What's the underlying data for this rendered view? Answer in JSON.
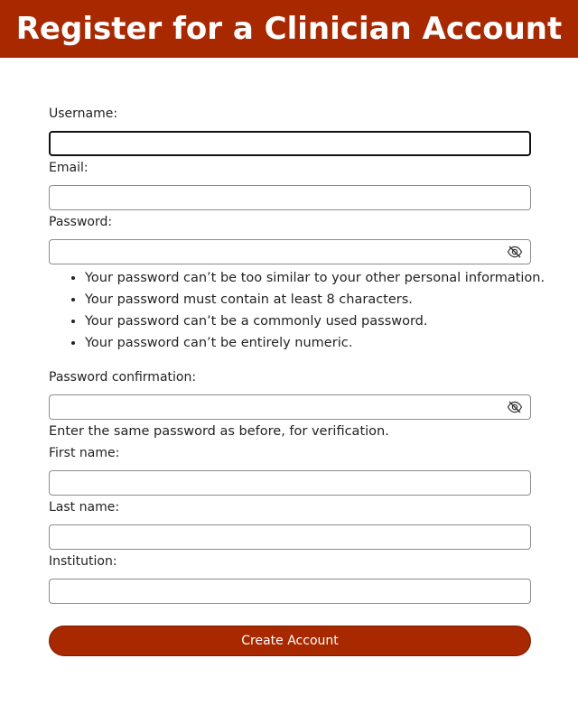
{
  "header": {
    "title": "Register for a Clinician Account"
  },
  "form": {
    "username": {
      "label": "Username:",
      "value": ""
    },
    "email": {
      "label": "Email:",
      "value": ""
    },
    "password": {
      "label": "Password:",
      "value": "",
      "toggle_icon": "eye-slash-icon",
      "rules": [
        "Your password can’t be too similar to your other personal information.",
        "Your password must contain at least 8 characters.",
        "Your password can’t be a commonly used password.",
        "Your password can’t be entirely numeric."
      ]
    },
    "password_confirmation": {
      "label": "Password confirmation:",
      "value": "",
      "toggle_icon": "eye-slash-icon",
      "help": "Enter the same password as before, for verification."
    },
    "first_name": {
      "label": "First name:",
      "value": ""
    },
    "last_name": {
      "label": "Last name:",
      "value": ""
    },
    "institution": {
      "label": "Institution:",
      "value": ""
    },
    "submit_label": "Create Account"
  },
  "colors": {
    "accent": "#a82800",
    "field_border": "#8c8c8c",
    "focused_border": "#111111"
  }
}
